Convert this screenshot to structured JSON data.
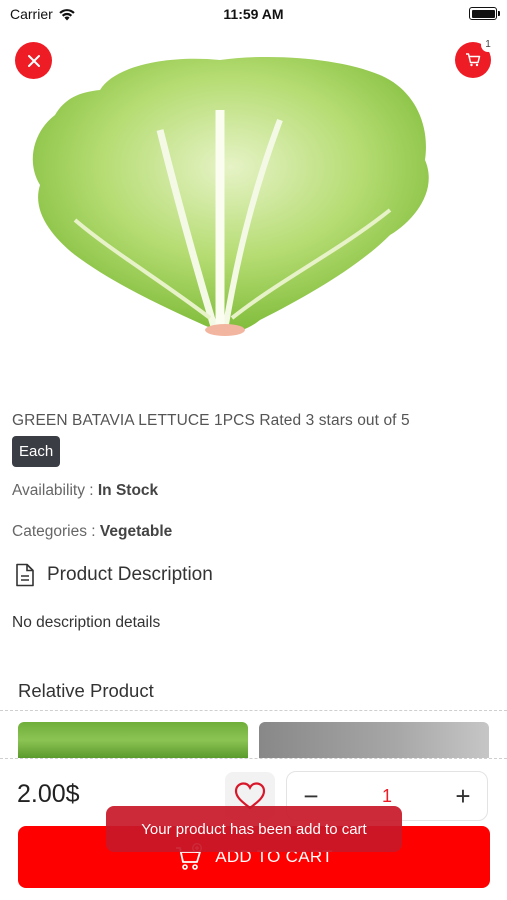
{
  "status_bar": {
    "carrier": "Carrier",
    "time": "11:59 AM"
  },
  "header": {
    "close_icon": "close-icon",
    "cart_icon": "cart-icon",
    "cart_count": "1"
  },
  "product": {
    "title": "GREEN BATAVIA LETTUCE 1PCS Rated 3 stars out of 5",
    "unit": "Each",
    "availability_label": "Availability : ",
    "availability_value": "In Stock",
    "categories_label": "Categories : ",
    "categories_value": "Vegetable",
    "description_title": "Product Description",
    "description_text": "No description details"
  },
  "relative": {
    "title": "Relative Product"
  },
  "bottom_bar": {
    "price": "2.00$",
    "quantity": "1",
    "minus": "−",
    "plus": "+",
    "add_to_cart": "ADD TO CART"
  },
  "toast": {
    "message": "Your product has been add to cart"
  },
  "colors": {
    "accent": "#ee1c25",
    "add_button": "#ff0000",
    "badge": "#3a3d44",
    "toast": "#c81828"
  }
}
